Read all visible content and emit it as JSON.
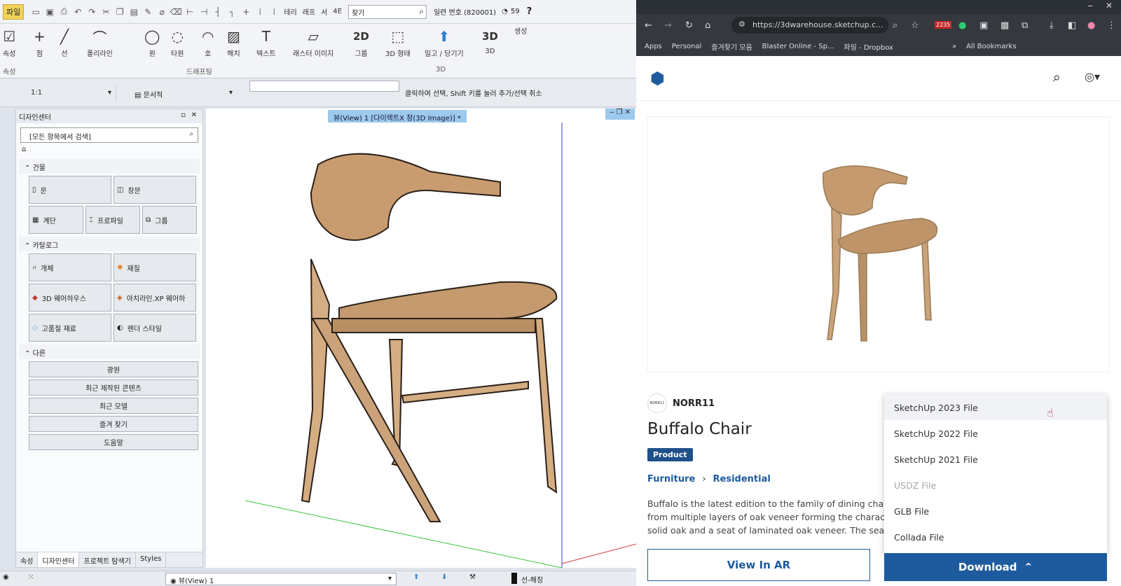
{
  "cad": {
    "file_button": "파일",
    "tabs": [
      "테리",
      "래프",
      "서",
      "4E"
    ],
    "find_value": "찾기",
    "serial": "일련 번호 (820001)",
    "counter": "59",
    "ribbon": {
      "tools": [
        "속성",
        "점",
        "선",
        "폴리라인",
        "원",
        "타원",
        "호",
        "해치",
        "텍스트",
        "래스터 이미지",
        "그룹",
        "3D 형태",
        "밀고 / 당기기",
        "3D",
        "생성"
      ],
      "groups": [
        "속성",
        "드래프팅",
        "3D"
      ]
    },
    "options": {
      "scale": "1:1",
      "layer": "문서적",
      "hint": "클릭하여 선택, Shift 키를 눌러 추가/선택 취소"
    },
    "design_center": {
      "title": "디자인센터",
      "search": "[모든 항목에서 검색]",
      "sections": [
        {
          "title": "건물",
          "items": [
            "문",
            "창문",
            "계단",
            "프로파일",
            "그룹"
          ]
        },
        {
          "title": "카탈로그",
          "items": [
            "개체",
            "재질",
            "3D 웨어하우스",
            "아치라인.XP 웨어하",
            "고품질 재료",
            "렌더 스타일"
          ]
        },
        {
          "title": "다른",
          "items": [
            "광원",
            "최근 제작된 콘텐츠",
            "최근 모델",
            "즐겨 찾기",
            "도움말"
          ]
        }
      ],
      "bottom_tabs": [
        "속성",
        "디자인센터",
        "프로젝트 탐색기",
        "Styles"
      ]
    },
    "viewport_title": "뷰(View) 1 [다이렉트X 창(3D Image)] *",
    "status": {
      "view": "뷰(View) 1",
      "layer": "선-해칭"
    }
  },
  "browser": {
    "url": "https://3dwarehouse.sketchup.c...",
    "ext_badge": "2235",
    "bookmarks": [
      "Apps",
      "Personal",
      "즐겨찾기 모음",
      "Blaster Online - Sp...",
      "파일 - Dropbox",
      "»",
      "All Bookmarks"
    ],
    "brand": "NORR11",
    "brand_logo_text": "NORR11",
    "product_title": "Buffalo Chair",
    "badge": "Product",
    "breadcrumb": [
      "Furniture",
      "Residential"
    ],
    "description": "Buffalo is the latest edition to the family of dining chairs from multiple layers of oak veneer forming the characte solid oak and a seat of laminated oak veneer. The seat is",
    "view_ar": "View In AR",
    "download": "Download",
    "download_options": [
      {
        "label": "SketchUp 2023 File",
        "disabled": false
      },
      {
        "label": "SketchUp 2022 File",
        "disabled": false
      },
      {
        "label": "SketchUp 2021 File",
        "disabled": false
      },
      {
        "label": "USDZ File",
        "disabled": true
      },
      {
        "label": "GLB File",
        "disabled": false
      },
      {
        "label": "Collada File",
        "disabled": false
      }
    ],
    "accent": "#1e5b9e"
  }
}
